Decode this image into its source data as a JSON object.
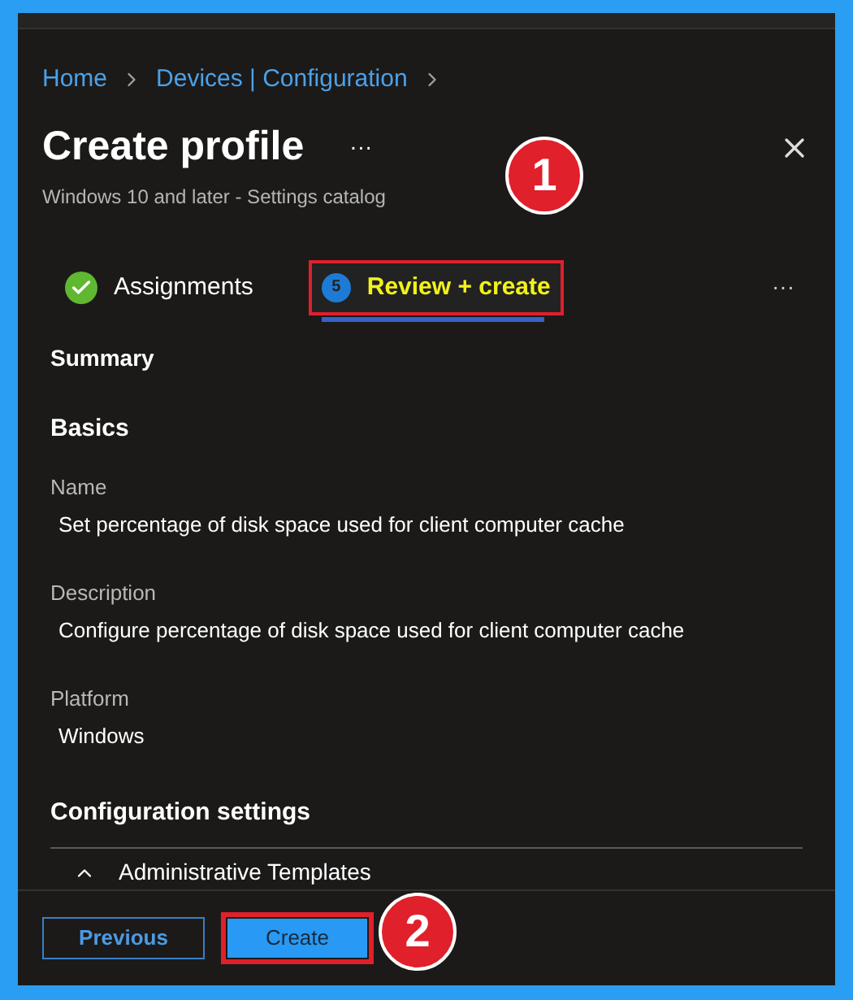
{
  "breadcrumb": [
    {
      "label": "Home"
    },
    {
      "label": "Devices | Configuration"
    }
  ],
  "title": "Create profile",
  "title_more": "···",
  "subtitle": "Windows 10 and later - Settings catalog",
  "steps": [
    {
      "label": "Assignments",
      "kind": "done",
      "selected": false
    },
    {
      "label": "Review + create",
      "kind": "current",
      "number": "5",
      "selected": true
    }
  ],
  "steps_more": "···",
  "summary": {
    "heading": "Summary",
    "section": "Basics",
    "fields": [
      {
        "label": "Name",
        "value": "Set percentage of disk space used for client computer cache"
      },
      {
        "label": "Description",
        "value": "Configure percentage of disk space used for client computer cache"
      },
      {
        "label": "Platform",
        "value": "Windows"
      }
    ],
    "config_heading": "Configuration settings",
    "group": {
      "label": "Administrative Templates",
      "expanded": true
    }
  },
  "buttons": [
    {
      "label": "Previous",
      "kind": "secondary"
    },
    {
      "label": "Create",
      "kind": "primary"
    }
  ],
  "annotations": [
    {
      "number": "1"
    },
    {
      "number": "2"
    }
  ]
}
